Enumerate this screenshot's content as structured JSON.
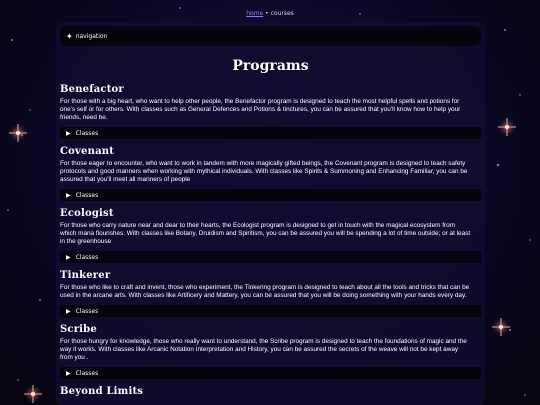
{
  "breadcrumb": {
    "home": "home",
    "separator": "•",
    "current": "courses"
  },
  "navigation": {
    "icon": "star-icon",
    "label": "navigation"
  },
  "page_title": "Programs",
  "programs": [
    {
      "title": "Benefactor",
      "description": "For those with a big heart, who want to help other people, the Benefactor program is designed to teach the most helpful spells and potions for one's self or for others. With classes such as General Defences and Potions & tinctures, you can be assured that you'll know how to help your friends, need be.",
      "classes_label": "Classes"
    },
    {
      "title": "Covenant",
      "description": "For those eager to encounter, who want to work in tandem with more magically gifted beings, the Covenant program is designed to teach safety protocols and good manners when working with mythical individuals. With classes like Spirits & Summoning and Enhancing Familiar, you can be assured that you'll meet all manners of people",
      "classes_label": "Classes"
    },
    {
      "title": "Ecologist",
      "description": "For those who carry nature near and dear to their hearts, the Ecologist program is designed to get in touch with the magical ecosystem from which mana flourishes. With classes like Botany, Druidism and Spiritism, you can be assured you will be spending a lot of time outside; or at least in the greenhouse",
      "classes_label": "Classes"
    },
    {
      "title": "Tinkerer",
      "description": "For those who like to craft and invent, those who experiment, the Tinkering program is designed to teach about all the tools and tricks that can be used in the arcane arts. With classes like Artificery and Mattery, you can be assured that you will be doing something with your hands every day.",
      "classes_label": "Classes"
    },
    {
      "title": "Scribe",
      "description": "For those hungry for knowledge, those who really want to understand, the Scribe program is designed to teach the foundations of magic and the way it works. With classes like Arcanic Notation Interpretation and History, you can be assured the secrets of the weave will not be kept away from you .",
      "classes_label": "Classes"
    },
    {
      "title": "Beyond Limits",
      "description": "",
      "classes_label": ""
    }
  ]
}
